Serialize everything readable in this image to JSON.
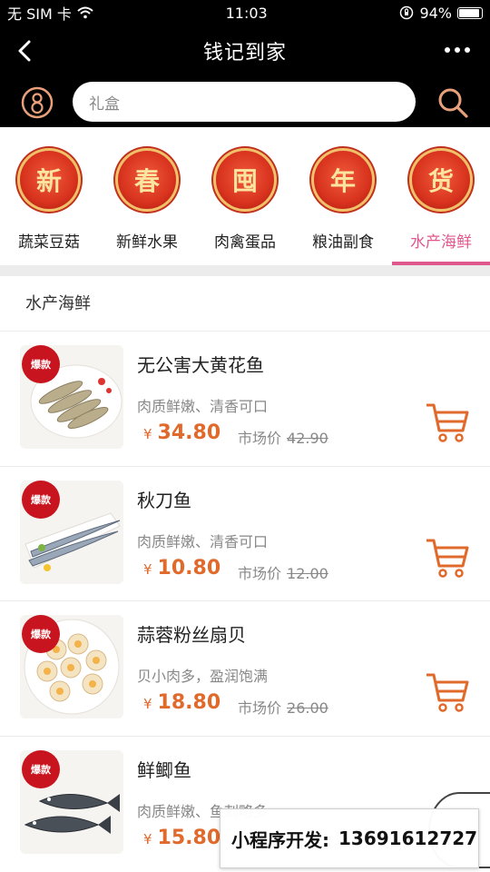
{
  "status": {
    "carrier": "无 SIM 卡",
    "time": "11:03",
    "battery": "94%",
    "battery_level": 0.94
  },
  "nav": {
    "title": "钱记到家"
  },
  "search": {
    "placeholder": "礼盒"
  },
  "categories": [
    {
      "badge": "新",
      "label": "蔬菜豆菇"
    },
    {
      "badge": "春",
      "label": "新鲜水果"
    },
    {
      "badge": "囤",
      "label": "肉禽蛋品"
    },
    {
      "badge": "年",
      "label": "粮油副食"
    },
    {
      "badge": "货",
      "label": "水产海鲜"
    }
  ],
  "active_category": "水产海鲜",
  "section_title": "水产海鲜",
  "products": [
    {
      "tag": "爆款",
      "name": "无公害大黄花鱼",
      "desc": "肉质鲜嫩、清香可口",
      "currency": "¥",
      "price": "34.80",
      "market_label": "市场价",
      "market_price": "42.90"
    },
    {
      "tag": "爆款",
      "name": "秋刀鱼",
      "desc": "肉质鲜嫩、清香可口",
      "currency": "¥",
      "price": "10.80",
      "market_label": "市场价",
      "market_price": "12.00"
    },
    {
      "tag": "爆款",
      "name": "蒜蓉粉丝扇贝",
      "desc": "贝小肉多，盈润饱满",
      "currency": "¥",
      "price": "18.80",
      "market_label": "市场价",
      "market_price": "26.00"
    },
    {
      "tag": "爆款",
      "name": "鲜鲫鱼",
      "desc": "肉质鲜嫩、鱼刺略多",
      "currency": "¥",
      "price": "15.80",
      "market_label": "",
      "market_price": ""
    }
  ],
  "banner": {
    "label": "小程序开发:",
    "phone": "13691612727"
  },
  "colors": {
    "accent": "#e0578e",
    "price": "#e06a2c",
    "badge": "#d8331e",
    "hot_tag": "#c8141e"
  }
}
